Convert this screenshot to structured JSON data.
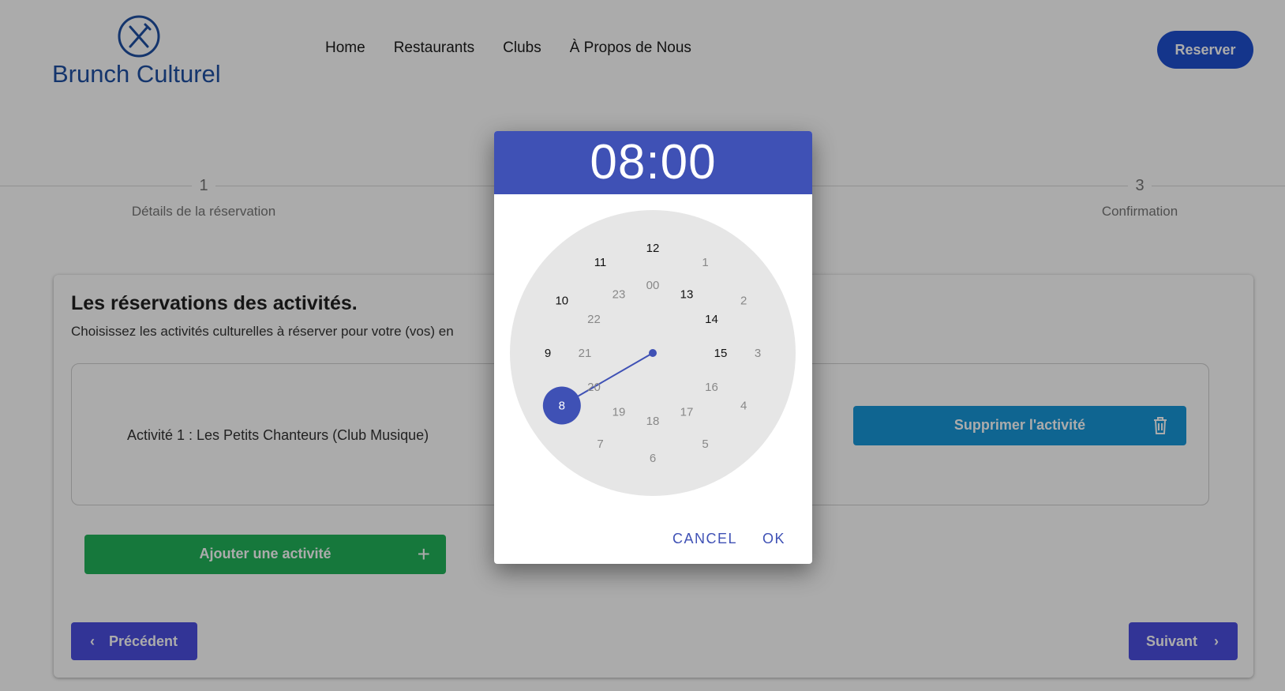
{
  "header": {
    "logo_text": "Brunch Culturel",
    "logo_icon": "fork-knife-icon",
    "nav": [
      "Home",
      "Restaurants",
      "Clubs",
      "À Propos de Nous"
    ],
    "reserve_label": "Reserver"
  },
  "stepper": {
    "steps": [
      {
        "num": "1",
        "label": "Détails de la réservation"
      },
      {
        "num": "3",
        "label": "Confirmation"
      }
    ]
  },
  "card": {
    "title": "Les réservations des activités.",
    "subtitle": "Choisissez les activités culturelles à réserver pour votre (vos) en",
    "activity_label": "Activité 1 : Les Petits Chanteurs (Club Musique)",
    "delete_label": "Supprimer l'activité",
    "delete_icon": "trash-icon",
    "add_label": "Ajouter une activité",
    "add_icon": "plus-icon",
    "prev_label": "Précédent",
    "prev_icon": "chevron-left-icon",
    "next_label": "Suivant",
    "next_icon": "chevron-right-icon"
  },
  "time_picker": {
    "time": "08:00",
    "selected_hour": "8",
    "outer_hours": [
      "12",
      "1",
      "2",
      "3",
      "4",
      "5",
      "6",
      "7",
      "8",
      "9",
      "10",
      "11"
    ],
    "inner_hours": [
      "00",
      "13",
      "14",
      "15",
      "16",
      "17",
      "18",
      "19",
      "20",
      "21",
      "22",
      "23"
    ],
    "cancel_label": "CANCEL",
    "ok_label": "OK",
    "accent": "#3f51b5"
  },
  "colors": {
    "logo": "#1f4fa3",
    "reserve_btn": "#1f4fcf",
    "delete_btn": "#1797d8",
    "add_btn": "#21b35a",
    "nav_btn": "#4b4ee0"
  }
}
